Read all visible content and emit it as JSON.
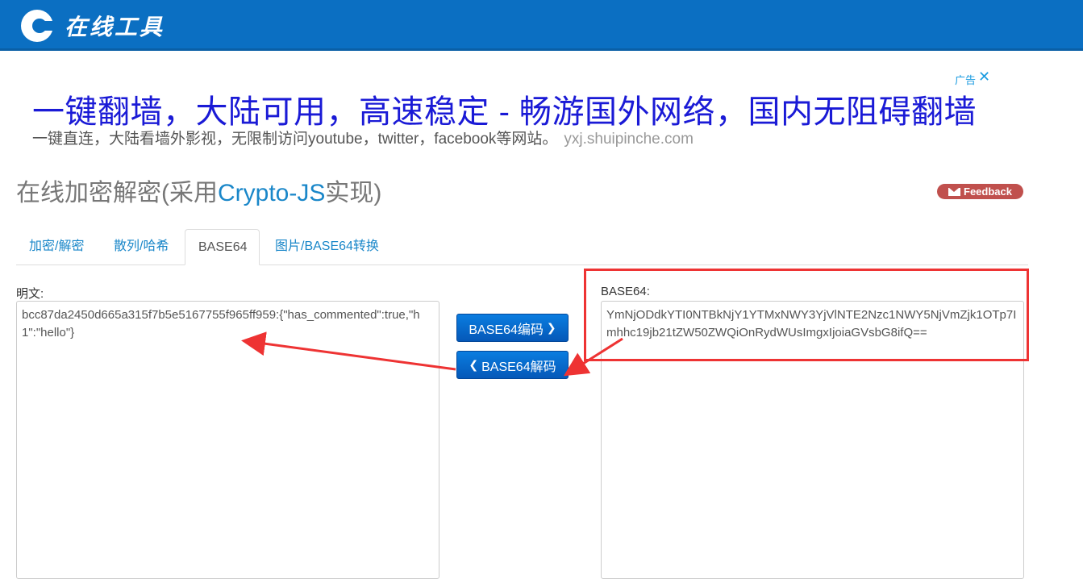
{
  "site": {
    "logo_text": "在线工具"
  },
  "ad": {
    "tag": "广告",
    "close": "✕",
    "title": "一键翻墙，大陆可用，高速稳定 - 畅游国外网络，国内无阻碍翻墙",
    "desc": "一键直连，大陆看墙外影视，无限制访问youtube，twitter，facebook等网站。",
    "url": "yxj.shuipinche.com"
  },
  "page": {
    "title_prefix": "在线加密解密(采用",
    "title_highlight": "Crypto-JS",
    "title_suffix": "实现)",
    "feedback_label": "Feedback"
  },
  "tabs": [
    {
      "label": "加密/解密"
    },
    {
      "label": "散列/哈希"
    },
    {
      "label": "BASE64"
    },
    {
      "label": "图片/BASE64转换"
    }
  ],
  "active_tab": "BASE64",
  "left": {
    "label": "明文:",
    "value": "bcc87da2450d665a315f7b5e5167755f965ff959:{\"has_commented\":true,\"h1\":\"hello\"}"
  },
  "right": {
    "label": "BASE64:",
    "value": "YmNjODdkYTI0NTBkNjY1YTMxNWY3YjVlNTE2Nzc1NWY5NjVmZjk1OTp7Imhhc19jb21tZW50ZWQiOnRydWUsImgxIjoiaGVsbG8ifQ=="
  },
  "buttons": {
    "encode": "BASE64编码",
    "decode": "BASE64解码"
  },
  "colors": {
    "brand": "#0b6fc2",
    "link": "#1a87c9",
    "annotation": "#e33333"
  }
}
